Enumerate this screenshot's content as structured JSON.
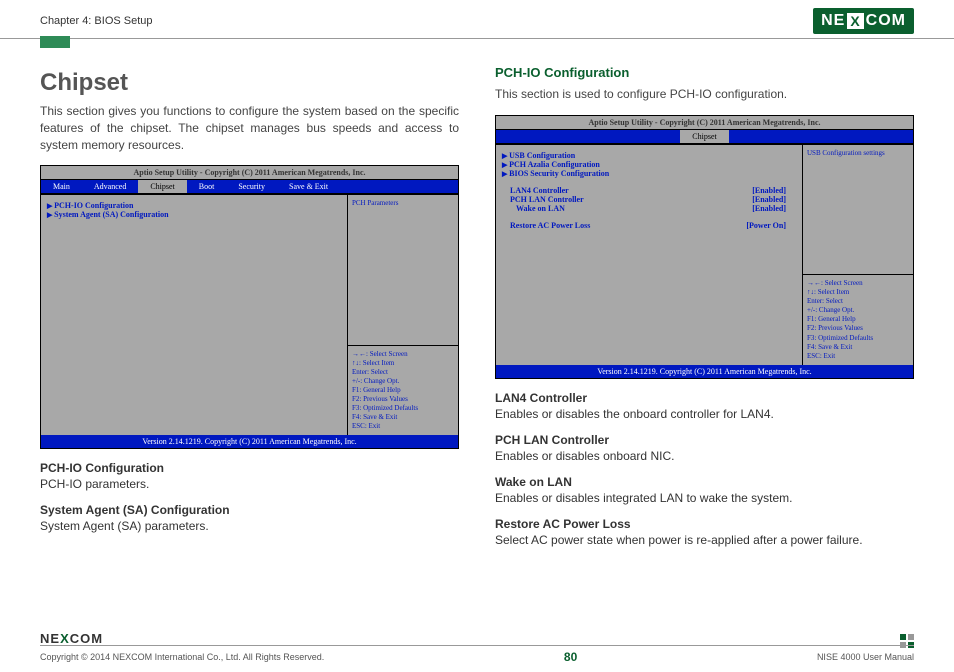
{
  "header": {
    "chapter": "Chapter 4: BIOS Setup",
    "logo_text_pre": "NE",
    "logo_text_x": "X",
    "logo_text_post": "COM"
  },
  "left": {
    "title": "Chipset",
    "intro": "This section gives you functions to configure the system based on the specific features of the chipset. The chipset manages bus speeds and access to system memory resources.",
    "bios": {
      "title": "Aptio Setup Utility - Copyright (C) 2011 American Megatrends, Inc.",
      "tabs": [
        "Main",
        "Advanced",
        "Chipset",
        "Boot",
        "Security",
        "Save & Exit"
      ],
      "active_tab": "Chipset",
      "items": [
        {
          "label": "PCH-IO Configuration",
          "arrow": true
        },
        {
          "label": "System Agent (SA) Configuration",
          "arrow": true
        }
      ],
      "side_top": "PCH Parameters",
      "help": [
        "→←: Select Screen",
        "↑↓: Select Item",
        "Enter: Select",
        "+/-: Change Opt.",
        "F1: General Help",
        "F2: Previous Values",
        "F3: Optimized Defaults",
        "F4: Save & Exit",
        "ESC: Exit"
      ],
      "footer": "Version 2.14.1219. Copyright (C) 2011 American Megatrends, Inc."
    },
    "subs": [
      {
        "heading": "PCH-IO Configuration",
        "text": "PCH-IO parameters."
      },
      {
        "heading": "System Agent (SA) Configuration",
        "text": "System Agent (SA) parameters."
      }
    ]
  },
  "right": {
    "section_heading": "PCH-IO Configuration",
    "intro": "This section is used to configure PCH-IO configuration.",
    "bios": {
      "title": "Aptio Setup Utility - Copyright (C) 2011 American Megatrends, Inc.",
      "tabs_single": "Chipset",
      "items_nav": [
        {
          "label": "USB Configuration"
        },
        {
          "label": "PCH Azalia Configuration"
        },
        {
          "label": "BIOS Security Configuration"
        }
      ],
      "items_val": [
        {
          "label": "LAN4 Controller",
          "value": "[Enabled]"
        },
        {
          "label": "PCH LAN Controller",
          "value": "[Enabled]"
        },
        {
          "label": "  Wake on LAN",
          "value": "[Enabled]"
        }
      ],
      "items_val2": [
        {
          "label": "Restore AC Power Loss",
          "value": "[Power On]"
        }
      ],
      "side_top": "USB Configuration settings",
      "help": [
        "→←: Select Screen",
        "↑↓: Select Item",
        "Enter: Select",
        "+/-: Change Opt.",
        "F1: General Help",
        "F2: Previous Values",
        "F3: Optimized Defaults",
        "F4: Save & Exit",
        "ESC: Exit"
      ],
      "footer": "Version 2.14.1219. Copyright (C) 2011 American Megatrends, Inc."
    },
    "subs": [
      {
        "heading": "LAN4 Controller",
        "text": "Enables or disables the onboard controller for LAN4."
      },
      {
        "heading": "PCH LAN Controller",
        "text": "Enables or disables onboard NIC."
      },
      {
        "heading": "Wake on LAN",
        "text": "Enables or disables integrated LAN to wake the system."
      },
      {
        "heading": "Restore AC Power Loss",
        "text": "Select AC power state when power is re-applied after a power failure."
      }
    ]
  },
  "footer": {
    "copyright": "Copyright © 2014 NEXCOM International Co., Ltd. All Rights Reserved.",
    "page": "80",
    "manual": "NISE 4000 User Manual",
    "mini_pre": "NE",
    "mini_x": "X",
    "mini_post": "COM"
  }
}
